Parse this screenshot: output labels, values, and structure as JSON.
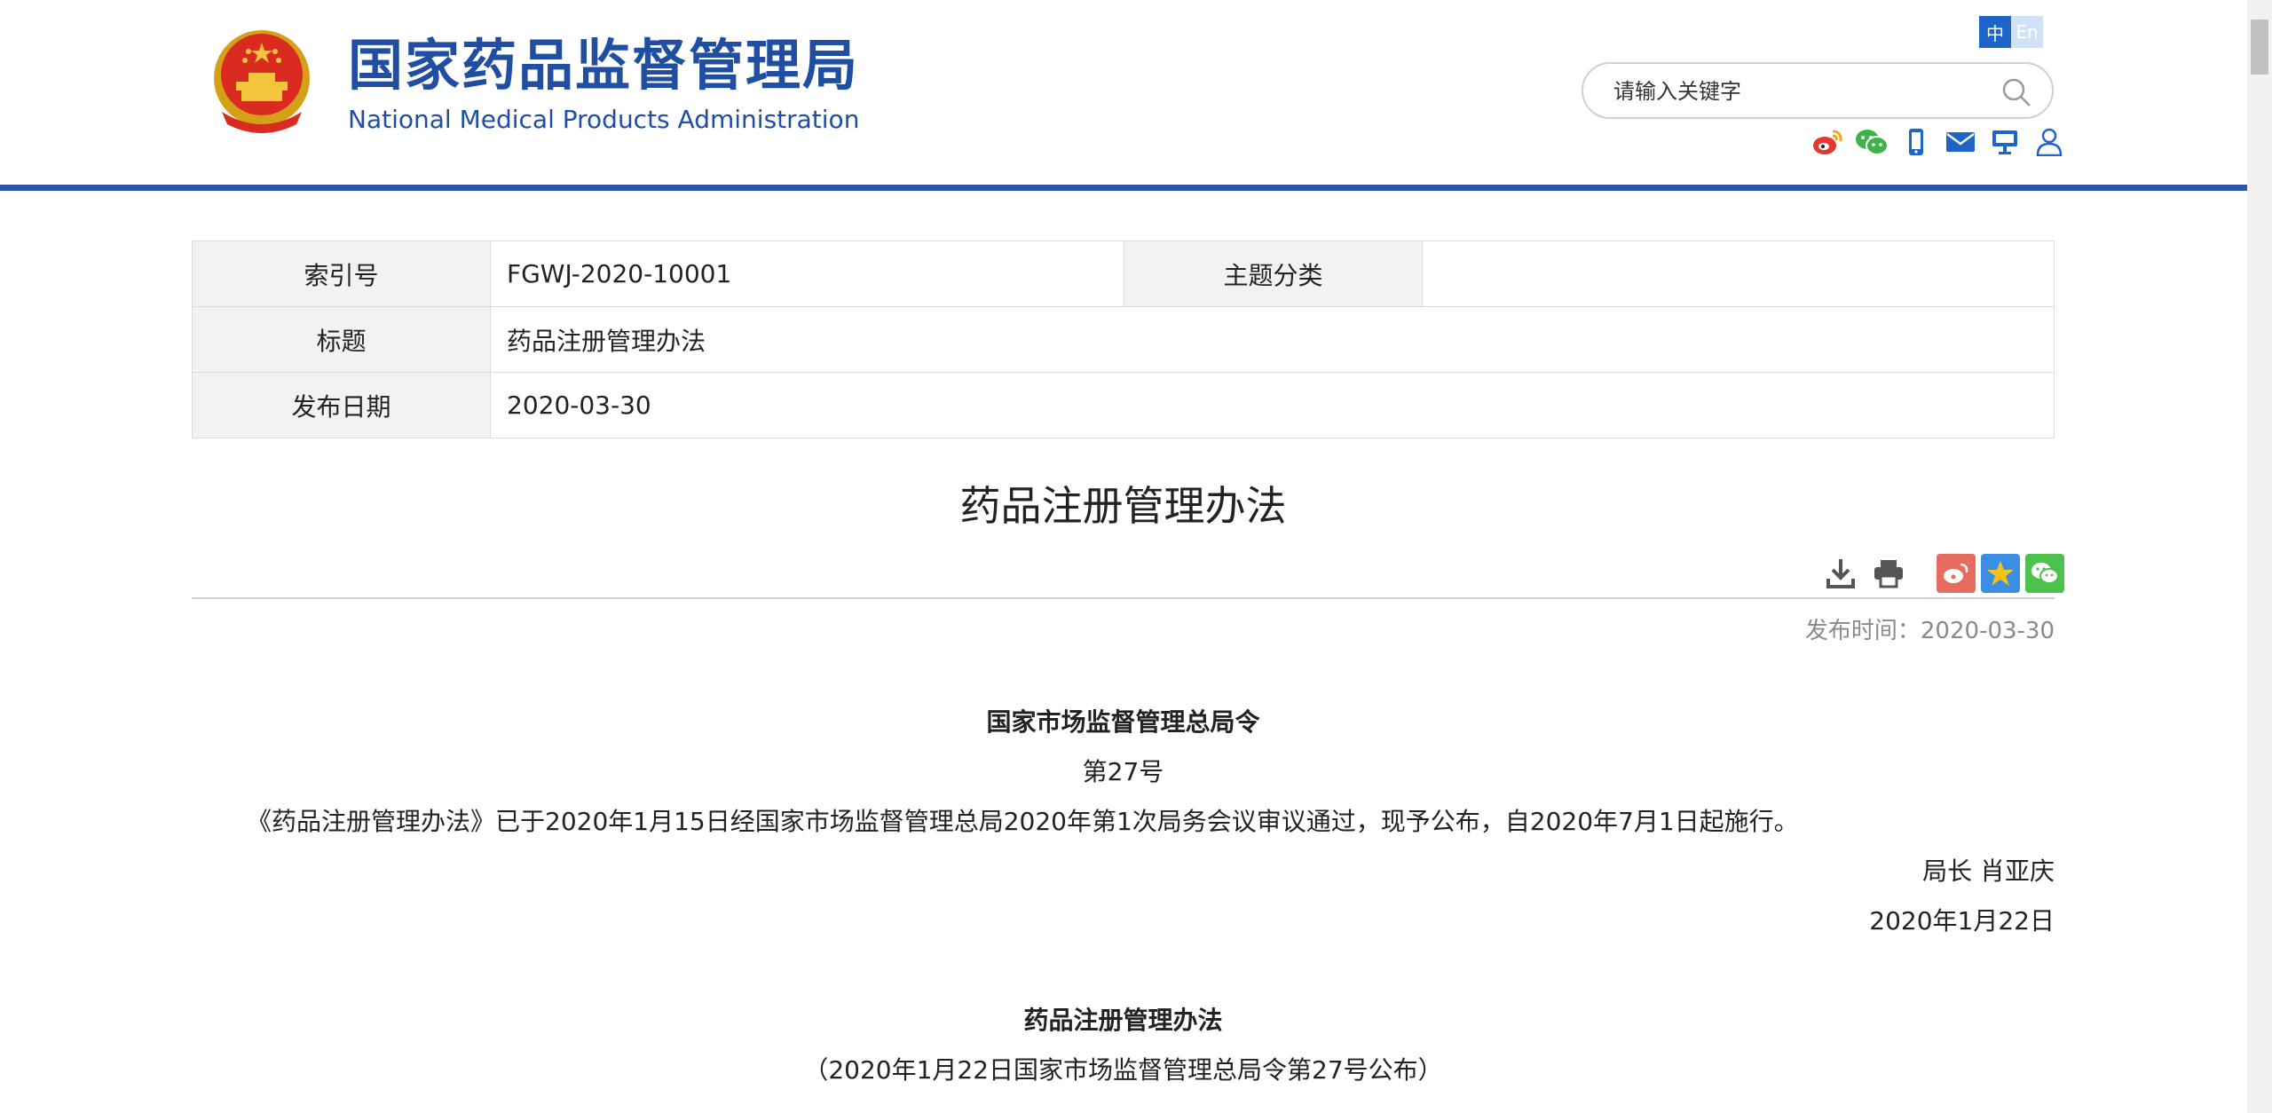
{
  "header": {
    "logo_cn": "国家药品监督管理局",
    "logo_en": "National Medical Products Administration",
    "lang": {
      "cn": "中",
      "en": "En"
    },
    "search": {
      "placeholder": "请输入关键字"
    },
    "social_icons": [
      "weibo-icon",
      "wechat-icon",
      "mobile-icon",
      "mail-icon",
      "screen-icon",
      "user-icon"
    ]
  },
  "info_table": {
    "index_label": "索引号",
    "index_value": "FGWJ-2020-10001",
    "topic_label": "主题分类",
    "topic_value": "",
    "title_label": "标题",
    "title_value": "药品注册管理办法",
    "date_label": "发布日期",
    "date_value": "2020-03-30"
  },
  "article": {
    "title": "药品注册管理办法",
    "pub_time": "发布时间：2020-03-30",
    "order_heading": "国家市场监督管理总局令",
    "order_number": "第27号",
    "order_text": "《药品注册管理办法》已于2020年1月15日经国家市场监督管理总局2020年第1次局务会议审议通过，现予公布，自2020年7月1日起施行。",
    "signature": "局长 肖亚庆",
    "sign_date": "2020年1月22日",
    "doc_title": "药品注册管理办法",
    "doc_subtitle": "（2020年1月22日国家市场监督管理总局令第27号公布）"
  },
  "colors": {
    "brand_blue": "#1f4ea3",
    "rule_blue": "#2b57a8",
    "weibo_red": "#e86b5f",
    "qzone_blue": "#3b8ee3",
    "wechat_green": "#4cc14c"
  }
}
